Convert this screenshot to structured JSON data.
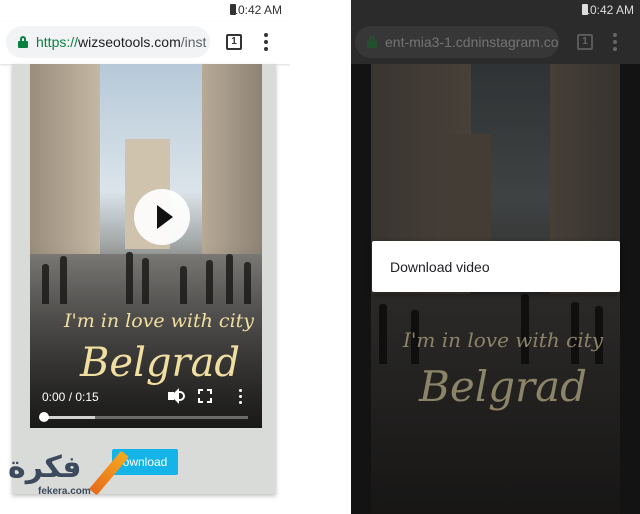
{
  "left_phone": {
    "status_time": "10:42 AM",
    "url": {
      "scheme": "https://",
      "host": "wizseotools.com",
      "path": "/inst"
    },
    "tab_count": "1",
    "video": {
      "overlay_line1": "I'm in love with city",
      "overlay_line2": "Belgrad",
      "time": "0:00 / 0:15",
      "progress_fraction": 0.0,
      "buffered_fraction": 0.25
    },
    "download_label": "ownload"
  },
  "right_phone": {
    "status_time": "10:42 AM",
    "url": "ent-mia3-1.cdninstagram.com",
    "tab_count": "1",
    "video": {
      "overlay_line1": "I'm in love with city",
      "overlay_line2": "Belgrad"
    },
    "context_menu": {
      "items": [
        "Download video"
      ]
    }
  },
  "watermark": {
    "word": "فكرة",
    "subtitle": "fekera.com"
  },
  "colors": {
    "secure_green": "#0b8043",
    "download_blue": "#15b4e8",
    "script_gold": "#f0dfa0"
  }
}
